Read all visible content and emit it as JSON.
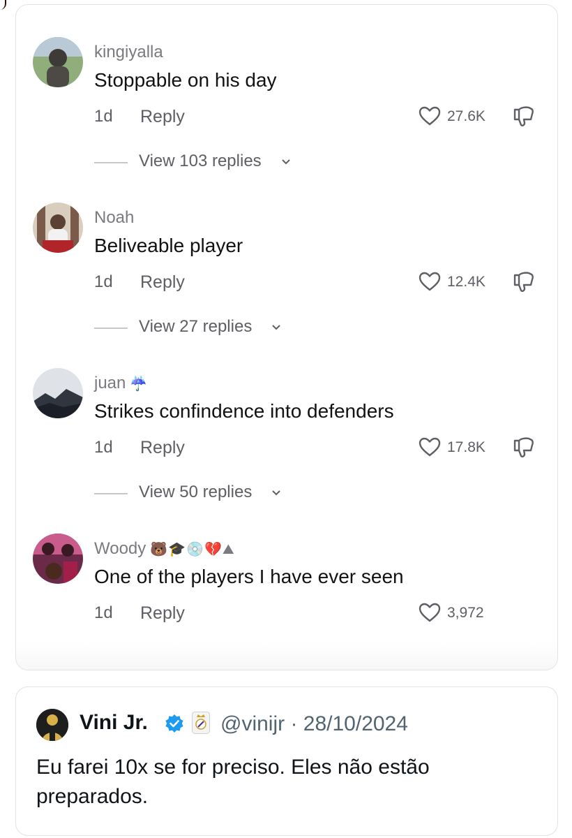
{
  "comments": [
    {
      "username": "kingiyalla",
      "emoji": "",
      "text": "Stoppable on his day",
      "time": "1d",
      "reply_label": "Reply",
      "likes": "27.6K",
      "replies_label": "View 103 replies"
    },
    {
      "username": "Noah",
      "emoji": "",
      "text": "Beliveable player",
      "time": "1d",
      "reply_label": "Reply",
      "likes": "12.4K",
      "replies_label": "View 27 replies"
    },
    {
      "username": "juan",
      "emoji": "☔",
      "text": "Strikes confindence into defenders",
      "time": "1d",
      "reply_label": "Reply",
      "likes": "17.8K",
      "replies_label": "View 50 replies"
    },
    {
      "username": "Woody",
      "emoji": "🐻🎓💿💔⛰",
      "text": "One of the players I have ever seen",
      "time": "1d",
      "reply_label": "Reply",
      "likes": "3,972",
      "replies_label": ""
    }
  ],
  "quoted_tweet": {
    "name": "Vini Jr.",
    "handle_date": "@vinijr · 28/10/2024",
    "text": "Eu farei 10x se for preciso. Eles não estão preparados."
  },
  "colors": {
    "verified": "#1d9bf0",
    "meta_text": "#5e5e64",
    "username": "#7a7a80"
  },
  "icons": [
    "heart-icon",
    "dislike-icon",
    "chevron-down-icon",
    "verified-badge-icon",
    "club-crest-icon"
  ]
}
